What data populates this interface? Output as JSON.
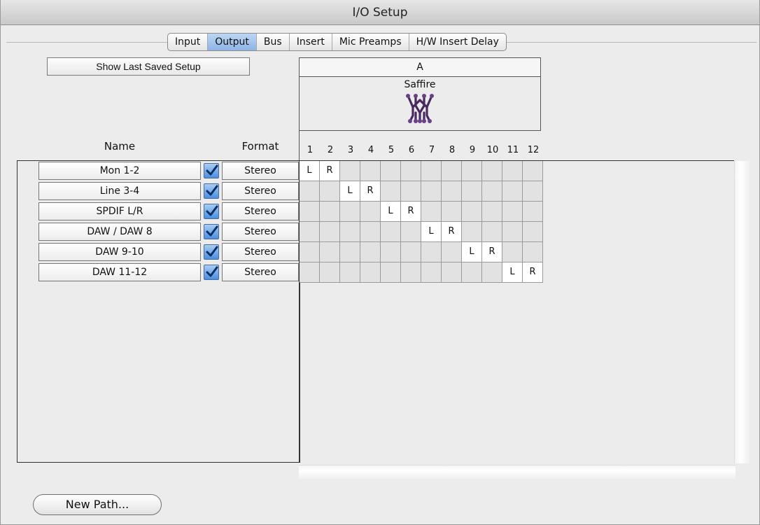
{
  "window": {
    "title": "I/O Setup"
  },
  "tabs": [
    {
      "label": "Input",
      "active": false
    },
    {
      "label": "Output",
      "active": true
    },
    {
      "label": "Bus",
      "active": false
    },
    {
      "label": "Insert",
      "active": false
    },
    {
      "label": "Mic Preamps",
      "active": false
    },
    {
      "label": "H/W Insert Delay",
      "active": false
    }
  ],
  "toolbar": {
    "show_last_saved_label": "Show Last Saved Setup"
  },
  "device": {
    "group_label": "A",
    "name": "Saffire",
    "logo_icon": "saffire-logo-icon",
    "channels": [
      "1",
      "2",
      "3",
      "4",
      "5",
      "6",
      "7",
      "8",
      "9",
      "10",
      "11",
      "12"
    ]
  },
  "columns": {
    "name_header": "Name",
    "format_header": "Format"
  },
  "paths": [
    {
      "name": "Mon 1-2",
      "enabled": true,
      "format": "Stereo",
      "L_channel": 1,
      "R_channel": 2
    },
    {
      "name": "Line 3-4",
      "enabled": true,
      "format": "Stereo",
      "L_channel": 3,
      "R_channel": 4
    },
    {
      "name": "SPDIF L/R",
      "enabled": true,
      "format": "Stereo",
      "L_channel": 5,
      "R_channel": 6
    },
    {
      "name": "DAW / DAW 8",
      "enabled": true,
      "format": "Stereo",
      "L_channel": 7,
      "R_channel": 8
    },
    {
      "name": "DAW 9-10",
      "enabled": true,
      "format": "Stereo",
      "L_channel": 9,
      "R_channel": 10
    },
    {
      "name": "DAW 11-12",
      "enabled": true,
      "format": "Stereo",
      "L_channel": 11,
      "R_channel": 12
    }
  ],
  "assignment_labels": {
    "left": "L",
    "right": "R"
  },
  "footer": {
    "new_path_label": "New Path..."
  },
  "colors": {
    "active_tab": "#9dc0ec",
    "checkbox": "#4a8ee0",
    "logo": "#4a2a5e"
  }
}
